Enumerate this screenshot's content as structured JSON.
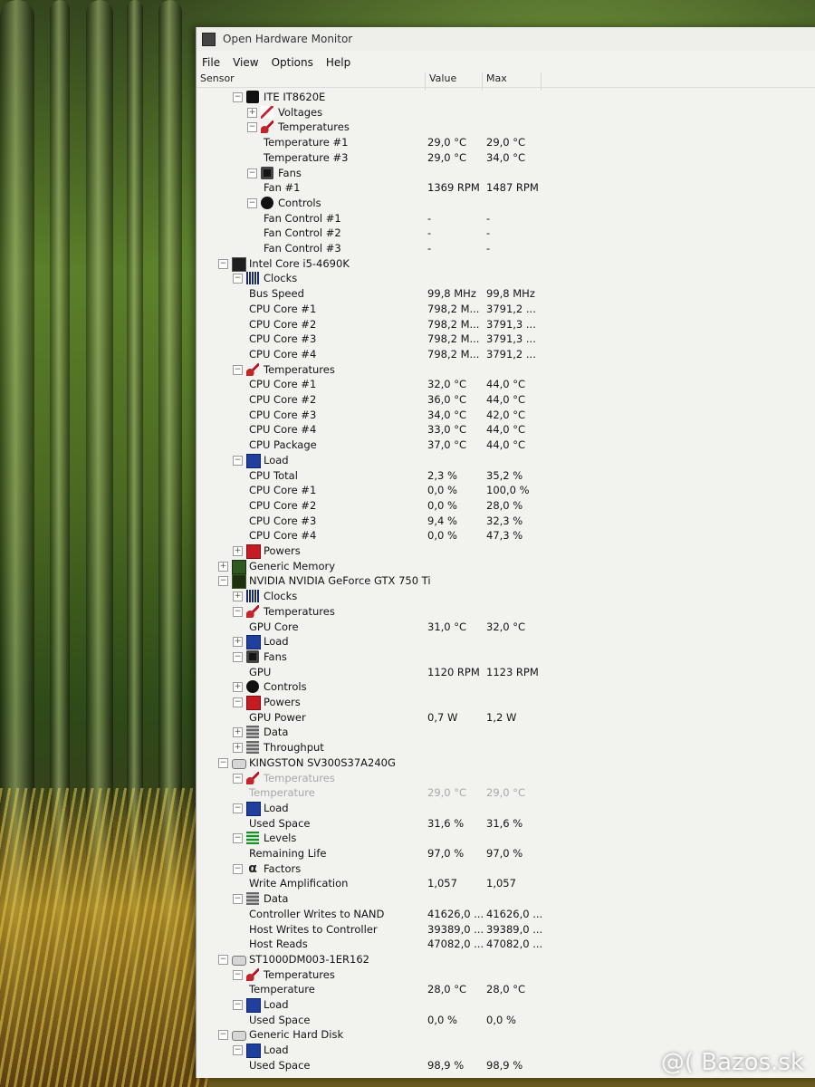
{
  "window": {
    "title": "Open Hardware Monitor"
  },
  "menu": [
    "File",
    "View",
    "Options",
    "Help"
  ],
  "columns": {
    "sensor": "Sensor",
    "value": "Value",
    "max": "Max"
  },
  "tree": [
    {
      "level": 1,
      "exp": "-",
      "icon": "chip-icon",
      "label": "ITE IT8620E",
      "value": "",
      "max": ""
    },
    {
      "level": 2,
      "exp": "+",
      "icon": "voltage-icon",
      "label": "Voltages",
      "value": "",
      "max": ""
    },
    {
      "level": 2,
      "exp": "-",
      "icon": "thermometer-icon",
      "label": "Temperatures",
      "value": "",
      "max": ""
    },
    {
      "level": 3,
      "exp": "",
      "icon": "",
      "label": "Temperature #1",
      "value": "29,0 °C",
      "max": "29,0 °C"
    },
    {
      "level": 3,
      "exp": "",
      "icon": "",
      "label": "Temperature #3",
      "value": "29,0 °C",
      "max": "34,0 °C"
    },
    {
      "level": 2,
      "exp": "-",
      "icon": "fan-icon",
      "label": "Fans",
      "value": "",
      "max": ""
    },
    {
      "level": 3,
      "exp": "",
      "icon": "",
      "label": "Fan #1",
      "value": "1369 RPM",
      "max": "1487 RPM"
    },
    {
      "level": 2,
      "exp": "-",
      "icon": "controls-icon",
      "label": "Controls",
      "value": "",
      "max": ""
    },
    {
      "level": 3,
      "exp": "",
      "icon": "",
      "label": "Fan Control #1",
      "value": "-",
      "max": "-"
    },
    {
      "level": 3,
      "exp": "",
      "icon": "",
      "label": "Fan Control #2",
      "value": "-",
      "max": "-"
    },
    {
      "level": 3,
      "exp": "",
      "icon": "",
      "label": "Fan Control #3",
      "value": "-",
      "max": "-"
    },
    {
      "level": 0,
      "exp": "-",
      "icon": "cpu-icon",
      "label": "Intel Core i5-4690K",
      "value": "",
      "max": ""
    },
    {
      "level": 1,
      "exp": "-",
      "icon": "clock-icon",
      "label": "Clocks",
      "value": "",
      "max": ""
    },
    {
      "level": 2,
      "exp": "",
      "icon": "",
      "label": "Bus Speed",
      "value": "99,8 MHz",
      "max": "99,8 MHz"
    },
    {
      "level": 2,
      "exp": "",
      "icon": "",
      "label": "CPU Core #1",
      "value": "798,2 M...",
      "max": "3791,2 ..."
    },
    {
      "level": 2,
      "exp": "",
      "icon": "",
      "label": "CPU Core #2",
      "value": "798,2 M...",
      "max": "3791,3 ..."
    },
    {
      "level": 2,
      "exp": "",
      "icon": "",
      "label": "CPU Core #3",
      "value": "798,2 M...",
      "max": "3791,3 ..."
    },
    {
      "level": 2,
      "exp": "",
      "icon": "",
      "label": "CPU Core #4",
      "value": "798,2 M...",
      "max": "3791,2 ..."
    },
    {
      "level": 1,
      "exp": "-",
      "icon": "thermometer-icon",
      "label": "Temperatures",
      "value": "",
      "max": ""
    },
    {
      "level": 2,
      "exp": "",
      "icon": "",
      "label": "CPU Core #1",
      "value": "32,0 °C",
      "max": "44,0 °C"
    },
    {
      "level": 2,
      "exp": "",
      "icon": "",
      "label": "CPU Core #2",
      "value": "36,0 °C",
      "max": "44,0 °C"
    },
    {
      "level": 2,
      "exp": "",
      "icon": "",
      "label": "CPU Core #3",
      "value": "34,0 °C",
      "max": "42,0 °C"
    },
    {
      "level": 2,
      "exp": "",
      "icon": "",
      "label": "CPU Core #4",
      "value": "33,0 °C",
      "max": "44,0 °C"
    },
    {
      "level": 2,
      "exp": "",
      "icon": "",
      "label": "CPU Package",
      "value": "37,0 °C",
      "max": "44,0 °C"
    },
    {
      "level": 1,
      "exp": "-",
      "icon": "load-icon",
      "label": "Load",
      "value": "",
      "max": ""
    },
    {
      "level": 2,
      "exp": "",
      "icon": "",
      "label": "CPU Total",
      "value": "2,3 %",
      "max": "35,2 %"
    },
    {
      "level": 2,
      "exp": "",
      "icon": "",
      "label": "CPU Core #1",
      "value": "0,0 %",
      "max": "100,0 %"
    },
    {
      "level": 2,
      "exp": "",
      "icon": "",
      "label": "CPU Core #2",
      "value": "0,0 %",
      "max": "28,0 %"
    },
    {
      "level": 2,
      "exp": "",
      "icon": "",
      "label": "CPU Core #3",
      "value": "9,4 %",
      "max": "32,3 %"
    },
    {
      "level": 2,
      "exp": "",
      "icon": "",
      "label": "CPU Core #4",
      "value": "0,0 %",
      "max": "47,3 %"
    },
    {
      "level": 1,
      "exp": "+",
      "icon": "power-icon",
      "label": "Powers",
      "value": "",
      "max": ""
    },
    {
      "level": 0,
      "exp": "+",
      "icon": "memory-icon",
      "label": "Generic Memory",
      "value": "",
      "max": ""
    },
    {
      "level": 0,
      "exp": "-",
      "icon": "gpu-icon",
      "label": "NVIDIA NVIDIA GeForce GTX 750 Ti",
      "value": "",
      "max": ""
    },
    {
      "level": 1,
      "exp": "+",
      "icon": "clock-icon",
      "label": "Clocks",
      "value": "",
      "max": ""
    },
    {
      "level": 1,
      "exp": "-",
      "icon": "thermometer-icon",
      "label": "Temperatures",
      "value": "",
      "max": ""
    },
    {
      "level": 2,
      "exp": "",
      "icon": "",
      "label": "GPU Core",
      "value": "31,0 °C",
      "max": "32,0 °C"
    },
    {
      "level": 1,
      "exp": "+",
      "icon": "load-icon",
      "label": "Load",
      "value": "",
      "max": ""
    },
    {
      "level": 1,
      "exp": "-",
      "icon": "fan-icon",
      "label": "Fans",
      "value": "",
      "max": ""
    },
    {
      "level": 2,
      "exp": "",
      "icon": "",
      "label": "GPU",
      "value": "1120 RPM",
      "max": "1123 RPM"
    },
    {
      "level": 1,
      "exp": "+",
      "icon": "controls-icon",
      "label": "Controls",
      "value": "",
      "max": ""
    },
    {
      "level": 1,
      "exp": "-",
      "icon": "power-icon",
      "label": "Powers",
      "value": "",
      "max": ""
    },
    {
      "level": 2,
      "exp": "",
      "icon": "",
      "label": "GPU Power",
      "value": "0,7 W",
      "max": "1,2 W"
    },
    {
      "level": 1,
      "exp": "+",
      "icon": "data-icon",
      "label": "Data",
      "value": "",
      "max": ""
    },
    {
      "level": 1,
      "exp": "+",
      "icon": "throughput-icon",
      "label": "Throughput",
      "value": "",
      "max": ""
    },
    {
      "level": 0,
      "exp": "-",
      "icon": "disk-icon",
      "label": "KINGSTON SV300S37A240G",
      "value": "",
      "max": ""
    },
    {
      "level": 1,
      "exp": "-",
      "icon": "thermometer-icon",
      "label": "Temperatures",
      "value": "",
      "max": "",
      "dim": true
    },
    {
      "level": 2,
      "exp": "",
      "icon": "",
      "label": "Temperature",
      "value": "29,0 °C",
      "max": "29,0 °C",
      "dim": true
    },
    {
      "level": 1,
      "exp": "-",
      "icon": "load-icon",
      "label": "Load",
      "value": "",
      "max": ""
    },
    {
      "level": 2,
      "exp": "",
      "icon": "",
      "label": "Used Space",
      "value": "31,6 %",
      "max": "31,6 %"
    },
    {
      "level": 1,
      "exp": "-",
      "icon": "levels-icon",
      "label": "Levels",
      "value": "",
      "max": ""
    },
    {
      "level": 2,
      "exp": "",
      "icon": "",
      "label": "Remaining Life",
      "value": "97,0 %",
      "max": "97,0 %"
    },
    {
      "level": 1,
      "exp": "-",
      "icon": "alpha-factor-icon",
      "label": "Factors",
      "value": "",
      "max": ""
    },
    {
      "level": 2,
      "exp": "",
      "icon": "",
      "label": "Write Amplification",
      "value": "1,057",
      "max": "1,057"
    },
    {
      "level": 1,
      "exp": "-",
      "icon": "data-icon",
      "label": "Data",
      "value": "",
      "max": ""
    },
    {
      "level": 2,
      "exp": "",
      "icon": "",
      "label": "Controller Writes to NAND",
      "value": "41626,0 ...",
      "max": "41626,0 ..."
    },
    {
      "level": 2,
      "exp": "",
      "icon": "",
      "label": "Host Writes to Controller",
      "value": "39389,0 ...",
      "max": "39389,0 ..."
    },
    {
      "level": 2,
      "exp": "",
      "icon": "",
      "label": "Host Reads",
      "value": "47082,0 ...",
      "max": "47082,0 ..."
    },
    {
      "level": 0,
      "exp": "-",
      "icon": "disk-icon",
      "label": "ST1000DM003-1ER162",
      "value": "",
      "max": ""
    },
    {
      "level": 1,
      "exp": "-",
      "icon": "thermometer-icon",
      "label": "Temperatures",
      "value": "",
      "max": ""
    },
    {
      "level": 2,
      "exp": "",
      "icon": "",
      "label": "Temperature",
      "value": "28,0 °C",
      "max": "28,0 °C"
    },
    {
      "level": 1,
      "exp": "-",
      "icon": "load-icon",
      "label": "Load",
      "value": "",
      "max": ""
    },
    {
      "level": 2,
      "exp": "",
      "icon": "",
      "label": "Used Space",
      "value": "0,0 %",
      "max": "0,0 %"
    },
    {
      "level": 0,
      "exp": "-",
      "icon": "disk-icon",
      "label": "Generic Hard Disk",
      "value": "",
      "max": ""
    },
    {
      "level": 1,
      "exp": "-",
      "icon": "load-icon",
      "label": "Load",
      "value": "",
      "max": ""
    },
    {
      "level": 2,
      "exp": "",
      "icon": "",
      "label": "Used Space",
      "value": "98,9 %",
      "max": "98,9 %"
    }
  ],
  "watermark": "@( Bazos.sk"
}
